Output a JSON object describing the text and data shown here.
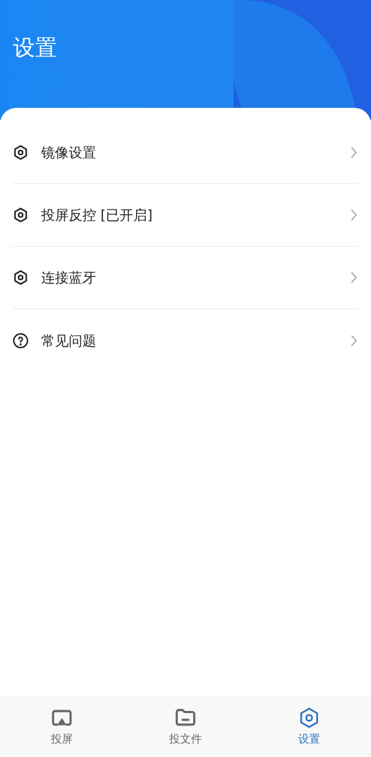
{
  "header": {
    "title": "设置"
  },
  "menu": [
    {
      "kind": "settings",
      "label": "镜像设置"
    },
    {
      "kind": "settings",
      "label": "投屏反控 [已开启]"
    },
    {
      "kind": "settings",
      "label": "连接蓝牙"
    },
    {
      "kind": "help",
      "label": "常见问题"
    }
  ],
  "tabs": [
    {
      "kind": "cast",
      "label": "投屏",
      "selected": false
    },
    {
      "kind": "folder",
      "label": "投文件",
      "selected": false
    },
    {
      "kind": "settings",
      "label": "设置",
      "selected": true
    }
  ]
}
